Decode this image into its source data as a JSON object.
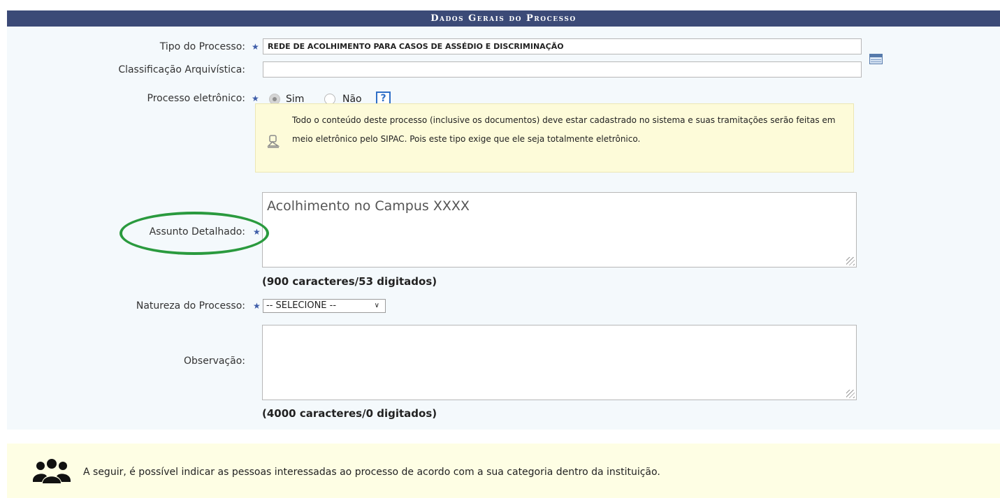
{
  "header": {
    "title": "Dados Gerais do Processo"
  },
  "form": {
    "tipo": {
      "label": "Tipo do Processo:",
      "value": "REDE DE ACOLHIMENTO PARA CASOS DE ASSÉDIO E DISCRIMINAÇÃO"
    },
    "classificacao": {
      "label": "Classificação Arquivística:",
      "value": ""
    },
    "eletronico": {
      "label": "Processo eletrônico:",
      "options": [
        {
          "label": "Sim",
          "checked": true
        },
        {
          "label": "Não",
          "checked": false
        }
      ],
      "help_glyph": "?"
    },
    "info_message": "Todo o conteúdo deste processo (inclusive os documentos) deve estar cadastrado no sistema e suas tramitações serão feitas em meio eletrônico pelo SIPAC. Pois este tipo exige que ele seja totalmente eletrônico.",
    "assunto": {
      "label": "Assunto Detalhado:",
      "value": "Acolhimento no Campus XXXX",
      "counter": "(900 caracteres/53 digitados)"
    },
    "natureza": {
      "label": "Natureza do Processo:",
      "selected": "-- SELECIONE --"
    },
    "observacao": {
      "label": "Observação:",
      "value": "",
      "counter": "(4000 caracteres/0 digitados)"
    }
  },
  "bottom_notice": "A seguir, é possível indicar as pessoas interessadas ao processo de acordo com a sua categoria dentro da instituição.",
  "icons": {
    "required": "required-star-icon",
    "table": "table-lookup-icon",
    "help": "help-icon",
    "info": "pin-icon",
    "people": "people-group-icon"
  },
  "colors": {
    "header_bg": "#3b4a77",
    "panel_bg": "#f4f9fc",
    "info_bg": "#fdfbd9",
    "required_star": "#3d5ca8",
    "highlight_ellipse": "#2a9a3e",
    "bottom_bg": "#fefee4"
  }
}
